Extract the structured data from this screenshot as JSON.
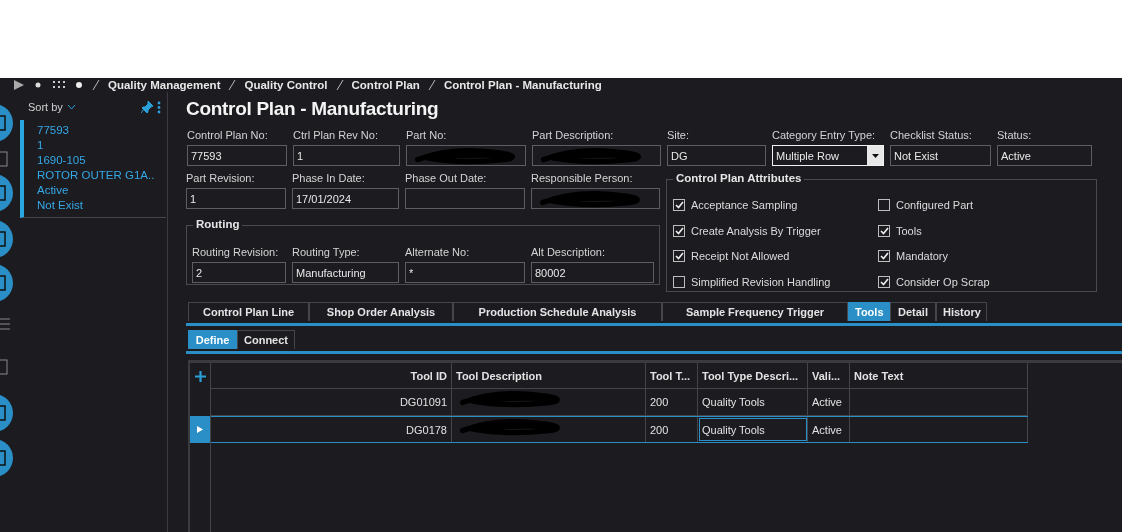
{
  "breadcrumb": [
    "Quality Management",
    "Quality Control",
    "Control Plan",
    "Control Plan - Manufacturing"
  ],
  "sidebar": {
    "sort_label": "Sort by",
    "records": [
      {
        "selected": true,
        "lines": [
          "77593",
          "1",
          "1690-105",
          "ROTOR OUTER G1A..",
          "Active",
          "Not Exist"
        ]
      }
    ]
  },
  "title": "Control Plan - Manufacturing",
  "fields": [
    {
      "label": "Control Plan No:",
      "kind": "text",
      "value": "77593"
    },
    {
      "label": "Ctrl Plan Rev No:",
      "kind": "text",
      "value": "1"
    },
    {
      "label": "Part No:",
      "kind": "redacted"
    },
    {
      "label": "Part Description:",
      "kind": "redacted"
    },
    {
      "label": "Site:",
      "kind": "text",
      "value": "DG"
    },
    {
      "label": "Category Entry Type:",
      "kind": "dropdown",
      "value": "Multiple Row"
    },
    {
      "label": "Checklist Status:",
      "kind": "text",
      "value": "Not Exist"
    },
    {
      "label": "Status:",
      "kind": "text",
      "value": "Active"
    },
    {
      "label": "Part Revision:",
      "kind": "text",
      "value": "1"
    },
    {
      "label": "Phase In Date:",
      "kind": "text",
      "value": "17/01/2024"
    },
    {
      "label": "Phase Out Date:",
      "kind": "text"
    },
    {
      "label": "Responsible Person:",
      "kind": "redacted"
    }
  ],
  "routing": {
    "title": "Routing",
    "fields": [
      {
        "label": "Routing Revision:",
        "kind": "text",
        "value": "2"
      },
      {
        "label": "Routing Type:",
        "kind": "text",
        "value": "Manufacturing"
      },
      {
        "label": "Alternate No:",
        "kind": "text",
        "value": "*"
      },
      {
        "label": "Alt Description:",
        "kind": "text",
        "value": "80002"
      }
    ]
  },
  "attributes": {
    "title": "Control Plan Attributes",
    "items": [
      {
        "label": "Acceptance Sampling",
        "checked": true
      },
      {
        "label": "Configured Part",
        "checked": false
      },
      {
        "label": "Create Analysis By Trigger",
        "checked": true
      },
      {
        "label": "Tools",
        "checked": true
      },
      {
        "label": "Receipt Not Allowed",
        "checked": true
      },
      {
        "label": "Mandatory",
        "checked": true
      },
      {
        "label": "Simplified Revision Handling",
        "checked": false
      },
      {
        "label": "Consider Op Scrap",
        "checked": true
      }
    ]
  },
  "tabs": [
    {
      "label": "Control Plan Line",
      "selected": false
    },
    {
      "label": "Shop Order Analysis",
      "selected": false
    },
    {
      "label": "Production Schedule Analysis",
      "selected": false
    },
    {
      "label": "Sample Frequency Trigger",
      "selected": false
    },
    {
      "label": "Tools",
      "selected": true
    },
    {
      "label": "Detail",
      "selected": false
    },
    {
      "label": "History",
      "selected": false
    }
  ],
  "subtabs": [
    {
      "label": "Define",
      "selected": true
    },
    {
      "label": "Connect",
      "selected": false
    }
  ],
  "grid": {
    "columns": [
      "Tool ID",
      "Tool Description",
      "Tool T...",
      "Tool Type Descri...",
      "Vali...",
      "Note Text"
    ],
    "rows": [
      {
        "selected": false,
        "cells": [
          {
            "text": "DG01091",
            "focused": false
          },
          {
            "kind": "redacted",
            "focused": false
          },
          {
            "text": "200",
            "focused": false
          },
          {
            "text": "Quality Tools",
            "focused": false
          },
          {
            "text": "Active",
            "focused": false
          }
        ]
      },
      {
        "selected": true,
        "cells": [
          {
            "text": "DG0178",
            "focused": false
          },
          {
            "kind": "redacted",
            "focused": false
          },
          {
            "text": "200",
            "focused": false
          },
          {
            "text": "Quality Tools",
            "focused": true
          },
          {
            "text": "Active",
            "focused": false
          }
        ]
      }
    ]
  }
}
